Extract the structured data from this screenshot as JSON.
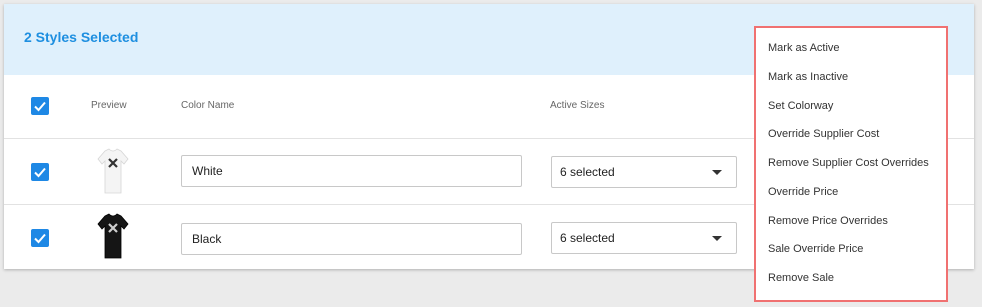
{
  "banner": {
    "title": "2 Styles Selected"
  },
  "table": {
    "headers": {
      "preview": "Preview",
      "color_name": "Color Name",
      "active_sizes": "Active Sizes"
    },
    "rows": [
      {
        "color_name": "White",
        "active_sizes": "6 selected",
        "checked": true,
        "shirt_color": "#f4f4f4"
      },
      {
        "color_name": "Black",
        "active_sizes": "6 selected",
        "checked": true,
        "shirt_color": "#151515"
      }
    ]
  },
  "menu": {
    "items": [
      "Mark as Active",
      "Mark as Inactive",
      "Set Colorway",
      "Override Supplier Cost",
      "Remove Supplier Cost Overrides",
      "Override Price",
      "Remove Price Overrides",
      "Sale Override Price",
      "Remove Sale"
    ]
  },
  "colors": {
    "accent": "#1e88e5",
    "banner_bg": "#dff0fc",
    "menu_border": "#f07171"
  }
}
